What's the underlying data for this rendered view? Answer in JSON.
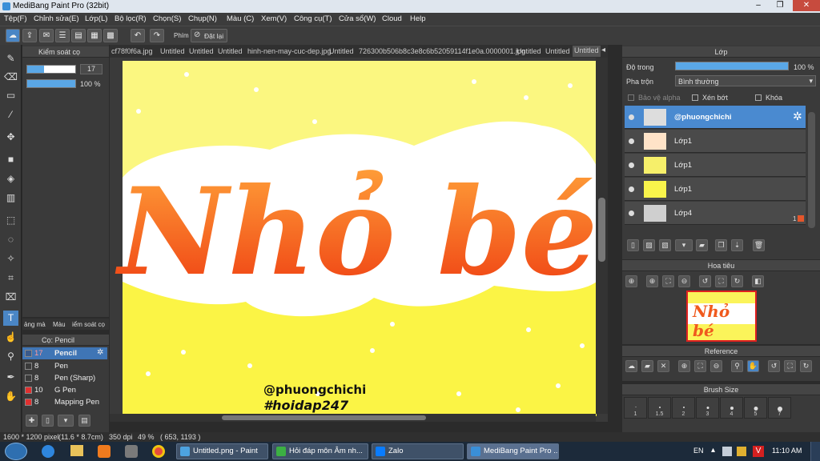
{
  "window": {
    "title": "MediBang Paint Pro (32bit)"
  },
  "menu": [
    "Tệp(F)",
    "Chỉnh sửa(E)",
    "Lớp(L)",
    "Bộ lọc(R)",
    "Chọn(S)",
    "Chụp(N)",
    "Màu (C)",
    "Xem(V)",
    "Công cụ(T)",
    "Cửa sổ(W)",
    "Cloud",
    "Help"
  ],
  "toolbar": {
    "phim_label": "Phím",
    "reset_label": "Đặt lại"
  },
  "tabs": [
    "cf78f0f6a.jpg",
    "Untitled",
    "Untitled",
    "Untitled",
    "hinh-nen-may-cuc-dep.jpg",
    "Untitled",
    "726300b506b8c3e8c6b52059114f1e0a.0000001.jpg",
    "Untitled",
    "Untitled",
    "Untitled"
  ],
  "brush_control": {
    "title": "Kiểm soát cọ",
    "size": "17",
    "opacity": "100 %"
  },
  "left_tabs": [
    "ảng mà",
    "Màu",
    "iểm soát cọ"
  ],
  "brush_panel": {
    "title": "Cọ: Pencil",
    "brushes": [
      {
        "num": "17",
        "name": "Pencil",
        "color": "#3a5a8a",
        "active": true
      },
      {
        "num": "8",
        "name": "Pen",
        "color": "#3a3a3a",
        "active": false
      },
      {
        "num": "8",
        "name": "Pen (Sharp)",
        "color": "#3a3a3a",
        "active": false
      },
      {
        "num": "10",
        "name": "G Pen",
        "color": "#e03030",
        "active": false
      },
      {
        "num": "8",
        "name": "Mapping Pen",
        "color": "#e03030",
        "active": false
      }
    ]
  },
  "artwork": {
    "title": "Nhỏ bé",
    "watermark1": "@phuongchichi",
    "watermark2": "#hoidap247"
  },
  "layer_panel": {
    "title": "Lớp",
    "opacity_label": "Độ trong",
    "opacity_value": "100 %",
    "opacity_fraction": 1.0,
    "blend_label": "Pha trộn",
    "blend_value": "Bình thường",
    "alpha_label": "Bảo vệ alpha",
    "clip_label": "Xén bớt",
    "lock_label": "Khóa",
    "layers": [
      {
        "name": "@phuongchichi",
        "selected": true
      },
      {
        "name": "Lớp1",
        "selected": false
      },
      {
        "name": "Lớp1",
        "selected": false
      },
      {
        "name": "Lớp1",
        "selected": false
      },
      {
        "name": "Lớp4",
        "selected": false,
        "badge": "1"
      }
    ]
  },
  "navigator": {
    "title": "Hoa tiêu",
    "thumb_text": "Nhỏ bé"
  },
  "reference": {
    "title": "Reference"
  },
  "brush_size": {
    "title": "Brush Size",
    "sizes": [
      "1",
      "1.5",
      "2",
      "3",
      "4",
      "5",
      "7"
    ]
  },
  "status": {
    "dims": "1600 * 1200 pixel",
    "size": "(11.6 * 8.7cm)",
    "dpi": "350 dpi",
    "zoom": "49 %",
    "coords": "( 653, 1193 )"
  },
  "taskbar": {
    "items": [
      {
        "label": "Untitled.png - Paint",
        "color": "#4da3e0"
      },
      {
        "label": "Hỏi đáp môn Âm nh...",
        "color": "#3cb043"
      },
      {
        "label": "Zalo",
        "color": "#0a7cff"
      },
      {
        "label": "MediBang Paint Pro ...",
        "color": "#3a8fd8"
      }
    ],
    "lang": "EN",
    "time": "11:10 AM"
  }
}
